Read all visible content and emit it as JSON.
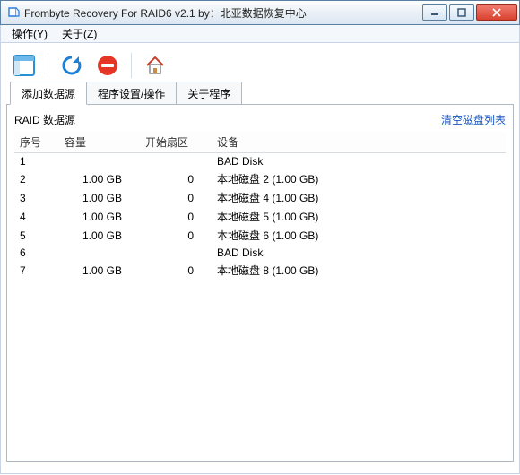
{
  "window": {
    "title": "Frombyte Recovery For RAID6 v2.1 by：北亚数据恢复中心"
  },
  "menu": {
    "operate": "操作(Y)",
    "about": "关于(Z)"
  },
  "toolbar": {
    "panel_icon": "panel-icon",
    "refresh_icon": "refresh-icon",
    "stop_icon": "stop-icon",
    "home_icon": "home-icon"
  },
  "tabs": {
    "add_source": "添加数据源",
    "settings": "程序设置/操作",
    "about_program": "关于程序"
  },
  "panel": {
    "section_title": "RAID 数据源",
    "clear_link": "清空磁盘列表",
    "columns": {
      "seq": "序号",
      "capacity": "容量",
      "start_sector": "开始扇区",
      "device": "设备"
    },
    "rows": [
      {
        "seq": "1",
        "capacity": "",
        "start_sector": "",
        "device": "BAD Disk"
      },
      {
        "seq": "2",
        "capacity": "1.00 GB",
        "start_sector": "0",
        "device": "本地磁盘 2  (1.00 GB)"
      },
      {
        "seq": "3",
        "capacity": "1.00 GB",
        "start_sector": "0",
        "device": "本地磁盘 4  (1.00 GB)"
      },
      {
        "seq": "4",
        "capacity": "1.00 GB",
        "start_sector": "0",
        "device": "本地磁盘 5  (1.00 GB)"
      },
      {
        "seq": "5",
        "capacity": "1.00 GB",
        "start_sector": "0",
        "device": "本地磁盘 6  (1.00 GB)"
      },
      {
        "seq": "6",
        "capacity": "",
        "start_sector": "",
        "device": "BAD Disk"
      },
      {
        "seq": "7",
        "capacity": "1.00 GB",
        "start_sector": "0",
        "device": "本地磁盘 8  (1.00 GB)"
      }
    ]
  }
}
